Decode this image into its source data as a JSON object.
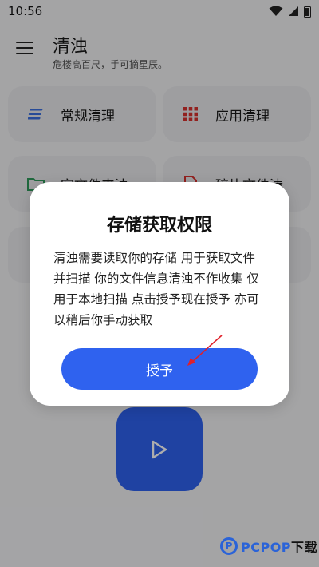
{
  "status_bar": {
    "time": "10:56"
  },
  "app_bar": {
    "title": "清浊",
    "subtitle": "危楼高百尺，手可摘星辰。"
  },
  "tiles": [
    {
      "label": "常规清理",
      "icon": "lines-icon"
    },
    {
      "label": "应用清理",
      "icon": "grid-icon"
    },
    {
      "label": "空文件夹清",
      "icon": "folder-icon"
    },
    {
      "label": "碎片文件清",
      "icon": "file-icon"
    }
  ],
  "dialog": {
    "title": "存储获取权限",
    "body": "清浊需要读取你的存储 用于获取文件并扫描 你的文件信息清浊不作收集 仅用于本地扫描 点击授予现在授予 亦可以稍后你手动获取",
    "grant_label": "授予"
  },
  "watermark": {
    "brand": "PCPOP",
    "suffix": "下载"
  },
  "colors": {
    "primary": "#2f62ef",
    "tile_bg": "#e9e9ec",
    "scrim": "rgba(0,0,0,0.32)",
    "annotation_arrow": "#e0202a"
  }
}
